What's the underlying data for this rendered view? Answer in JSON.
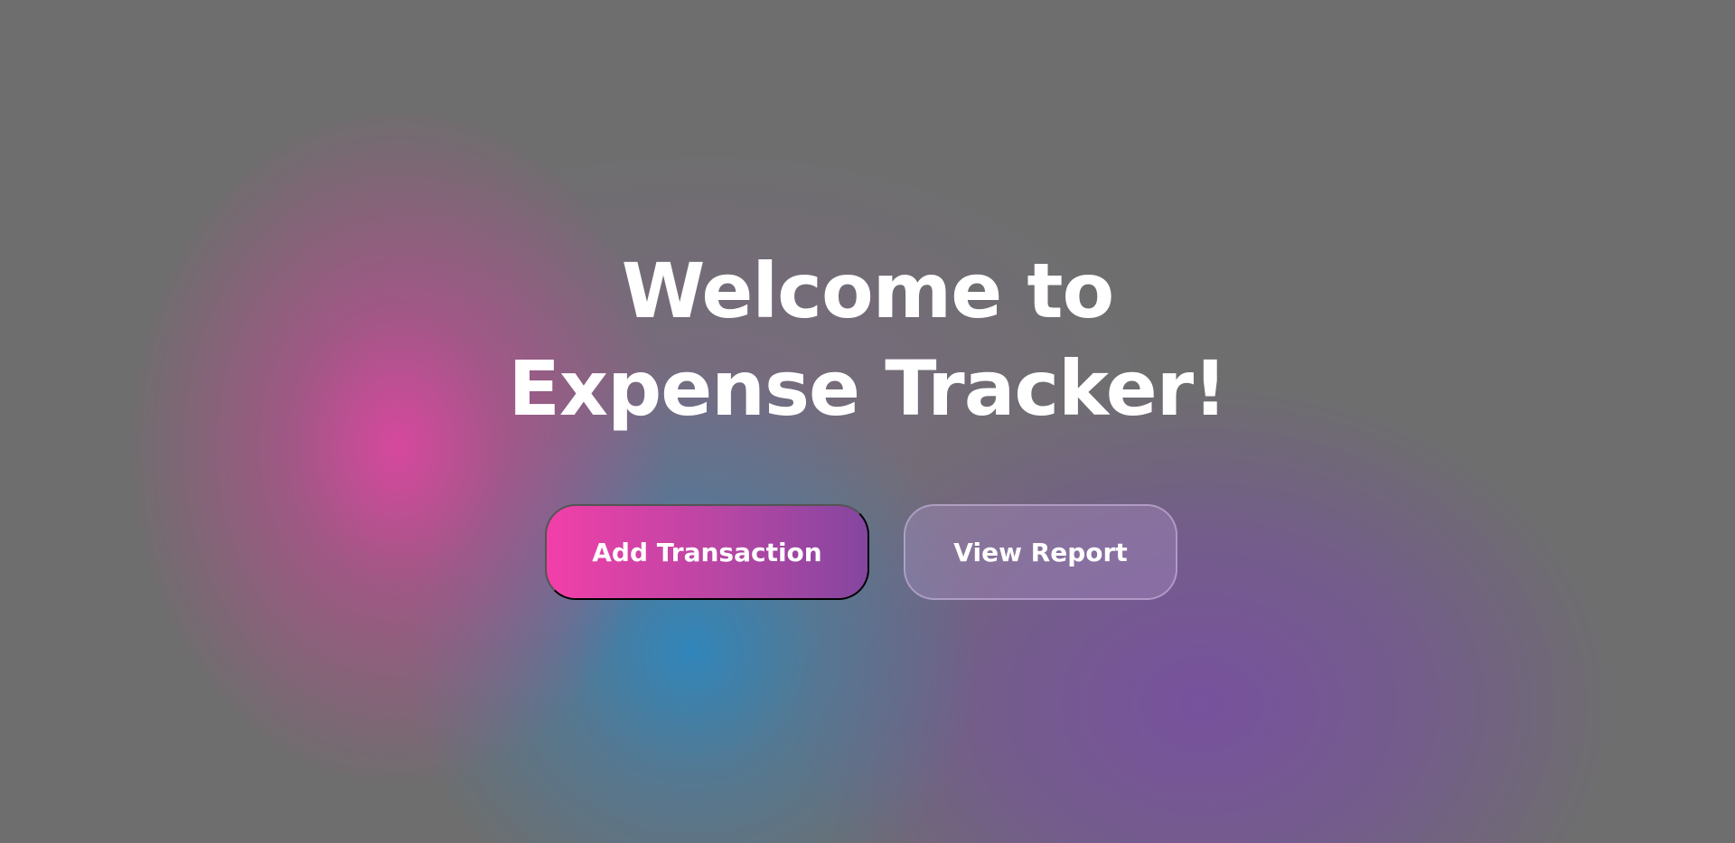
{
  "hero": {
    "title_line1": "Welcome to",
    "title_line2": "Expense Tracker!"
  },
  "actions": {
    "add_transaction_label": "Add Transaction",
    "view_report_label": "View Report"
  },
  "colors": {
    "background": "#6e6e6e",
    "primary_gradient_start": "#f23fa8",
    "primary_gradient_end": "#8446a0",
    "blob_pink": "#dc46a0",
    "blob_blue": "#2d87be",
    "blob_purple": "#7850a0"
  }
}
